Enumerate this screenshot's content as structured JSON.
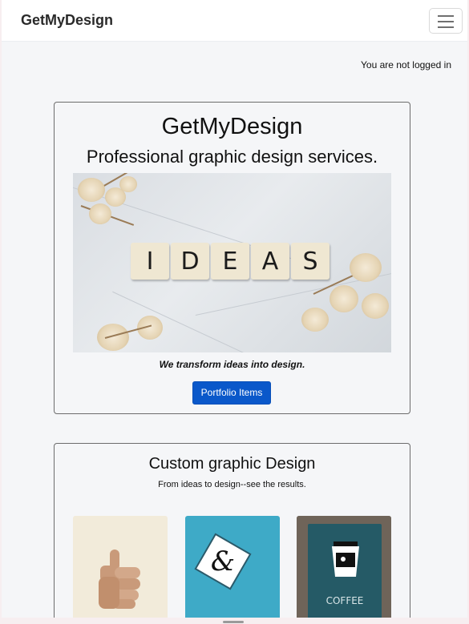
{
  "navbar": {
    "brand": "GetMyDesign",
    "menu_icon": "hamburger-menu-icon"
  },
  "auth": {
    "status": "You are not logged in"
  },
  "hero": {
    "title": "GetMyDesign",
    "tagline": "Professional graphic design services.",
    "image": {
      "tiles": [
        "I",
        "D",
        "E",
        "A",
        "S"
      ]
    },
    "caption": "We transform ideas into design.",
    "button_label": "Portfolio Items"
  },
  "custom_section": {
    "title": "Custom graphic Design",
    "subtitle": "From ideas to design--see the results.",
    "thumbnails": [
      {
        "icon": "thumbs-up-icon"
      },
      {
        "icon": "ampersand-icon",
        "glyph": "&"
      },
      {
        "icon": "coffee-cup-icon",
        "lines": [
          "COFFEE"
        ]
      }
    ]
  },
  "colors": {
    "primary_button": "#0a58ca",
    "background": "#f5f6f8",
    "navbar": "#ffffff"
  }
}
